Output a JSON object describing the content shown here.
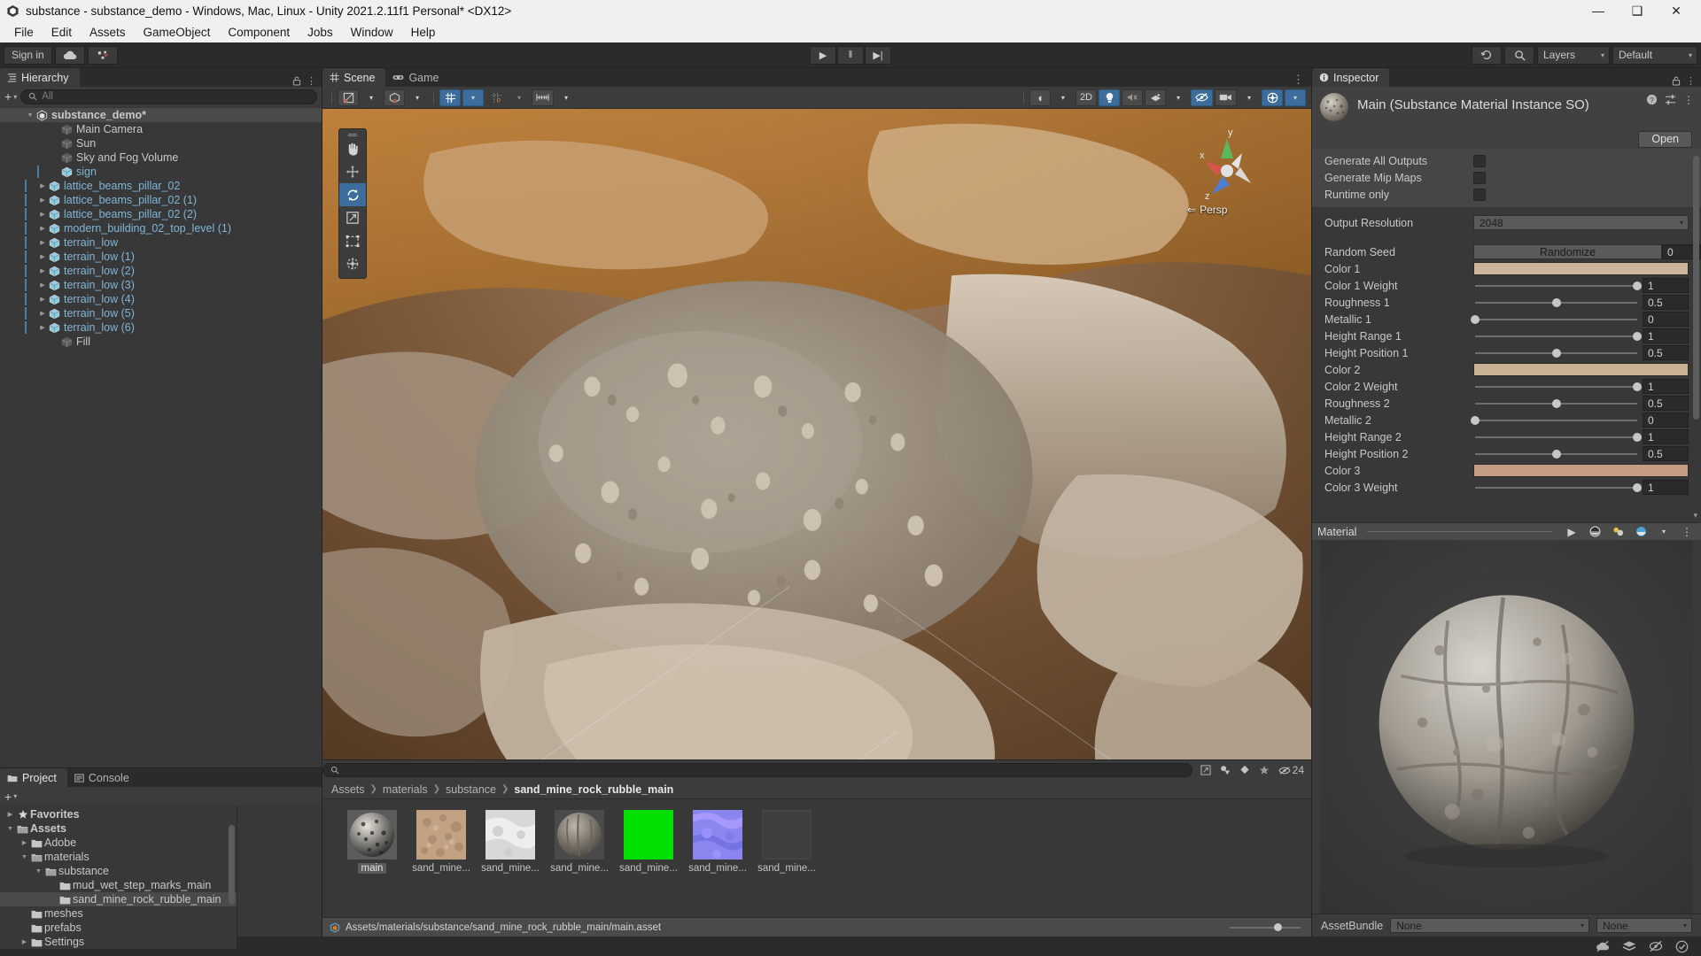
{
  "window": {
    "title": "substance - substance_demo - Windows, Mac, Linux - Unity 2021.2.11f1 Personal* <DX12>",
    "app_icon": "unity-icon",
    "minimize": "—",
    "maximize": "❑",
    "close": "✕"
  },
  "menu": {
    "items": [
      "File",
      "Edit",
      "Assets",
      "GameObject",
      "Component",
      "Jobs",
      "Window",
      "Help"
    ]
  },
  "toolbar": {
    "signin_label": "Sign in",
    "cloud_icon": "cloud-icon",
    "collab_icon": "collab-icon",
    "play_icon": "▶",
    "pause_icon": "‖",
    "step_icon": "▶|",
    "history_icon": "undo-history-icon",
    "search_icon": "search-icon",
    "layers_label": "Layers",
    "layout_label": "Default",
    "caret": "▾"
  },
  "hierarchy": {
    "tab_label": "Hierarchy",
    "tab_icon": "hierarchy-icon",
    "add_icon": "+",
    "search_placeholder": "All",
    "search_icon": "search-icon",
    "lock_icon": "lock-icon",
    "menu_icon": "⋮",
    "items": [
      {
        "label": "substance_demo*",
        "depth": 0,
        "icon": "scene-icon",
        "expand": "▼",
        "selected": true,
        "prefab": false
      },
      {
        "label": "Main Camera",
        "depth": 2,
        "icon": "gameobject-icon",
        "expand": "",
        "selected": false,
        "prefab": false
      },
      {
        "label": "Sun",
        "depth": 2,
        "icon": "gameobject-icon",
        "expand": "",
        "selected": false,
        "prefab": false
      },
      {
        "label": "Sky and Fog Volume",
        "depth": 2,
        "icon": "gameobject-icon",
        "expand": "",
        "selected": false,
        "prefab": false
      },
      {
        "label": "sign",
        "depth": 2,
        "icon": "prefab-icon",
        "expand": "",
        "selected": false,
        "prefab": true
      },
      {
        "label": "lattice_beams_pillar_02",
        "depth": 1,
        "icon": "prefab-icon",
        "expand": "▶",
        "selected": false,
        "prefab": true
      },
      {
        "label": "lattice_beams_pillar_02 (1)",
        "depth": 1,
        "icon": "prefab-icon",
        "expand": "▶",
        "selected": false,
        "prefab": true
      },
      {
        "label": "lattice_beams_pillar_02 (2)",
        "depth": 1,
        "icon": "prefab-icon",
        "expand": "▶",
        "selected": false,
        "prefab": true
      },
      {
        "label": "modern_building_02_top_level (1)",
        "depth": 1,
        "icon": "prefab-icon",
        "expand": "▶",
        "selected": false,
        "prefab": true
      },
      {
        "label": "terrain_low",
        "depth": 1,
        "icon": "prefab-icon",
        "expand": "▶",
        "selected": false,
        "prefab": true
      },
      {
        "label": "terrain_low (1)",
        "depth": 1,
        "icon": "prefab-icon",
        "expand": "▶",
        "selected": false,
        "prefab": true
      },
      {
        "label": "terrain_low (2)",
        "depth": 1,
        "icon": "prefab-icon",
        "expand": "▶",
        "selected": false,
        "prefab": true
      },
      {
        "label": "terrain_low (3)",
        "depth": 1,
        "icon": "prefab-icon",
        "expand": "▶",
        "selected": false,
        "prefab": true
      },
      {
        "label": "terrain_low (4)",
        "depth": 1,
        "icon": "prefab-icon",
        "expand": "▶",
        "selected": false,
        "prefab": true
      },
      {
        "label": "terrain_low (5)",
        "depth": 1,
        "icon": "prefab-icon",
        "expand": "▶",
        "selected": false,
        "prefab": true
      },
      {
        "label": "terrain_low (6)",
        "depth": 1,
        "icon": "prefab-icon",
        "expand": "▶",
        "selected": false,
        "prefab": true
      },
      {
        "label": "Fill",
        "depth": 2,
        "icon": "gameobject-icon",
        "expand": "",
        "selected": false,
        "prefab": false
      }
    ]
  },
  "scene": {
    "tab_scene": "Scene",
    "tab_game": "Game",
    "scene_icon": "grid-icon",
    "game_icon": "gamepad-icon",
    "menu_icon": "⋮",
    "tools": [
      {
        "name": "hand-tool",
        "glyph": "✋",
        "active": false
      },
      {
        "name": "move-tool",
        "glyph": "✥",
        "active": false
      },
      {
        "name": "rotate-tool",
        "glyph": "⟳",
        "active": true
      },
      {
        "name": "scale-tool",
        "glyph": "⤡",
        "active": false
      },
      {
        "name": "rect-tool",
        "glyph": "⬚",
        "active": false
      },
      {
        "name": "transform-tool",
        "glyph": "✸",
        "active": false
      }
    ],
    "toolbar_right": [
      {
        "name": "shading-mode",
        "label": "◐",
        "active": false,
        "caret": true
      },
      {
        "name": "2d-toggle",
        "label": "2D",
        "active": false,
        "caret": false
      },
      {
        "name": "lighting-toggle",
        "label": "💡",
        "active": true,
        "caret": false
      },
      {
        "name": "audio-toggle",
        "label": "🔊",
        "active": false,
        "caret": false
      },
      {
        "name": "effects-toggle",
        "label": "❆",
        "active": false,
        "caret": true
      },
      {
        "name": "scene-visibility-toggle",
        "label": "👁",
        "active": true,
        "caret": false
      },
      {
        "name": "camera-settings",
        "label": "■",
        "active": false,
        "caret": true
      },
      {
        "name": "gizmos-toggle",
        "label": "⊙",
        "active": true,
        "caret": true
      }
    ],
    "gizmo": {
      "x_label": "x",
      "y_label": "y",
      "z_label": "z",
      "projection_label": "Persp",
      "x_color": "#d9534f",
      "y_color": "#5cb85c",
      "z_color": "#4a7fd4"
    }
  },
  "inspector": {
    "tab_label": "Inspector",
    "tab_icon": "info-icon",
    "lock_icon": "lock-icon",
    "menu_icon": "⋮",
    "asset_title": "Main (Substance Material Instance SO)",
    "help_icon": "help-icon",
    "preset_icon": "preset-icon",
    "open_label": "Open",
    "toggles": [
      {
        "label": "Generate All Outputs",
        "checked": false
      },
      {
        "label": "Generate Mip Maps",
        "checked": false
      },
      {
        "label": "Runtime only",
        "checked": false
      }
    ],
    "output_resolution": {
      "label": "Output Resolution",
      "value": "2048"
    },
    "random_seed": {
      "label": "Random Seed",
      "button": "Randomize",
      "value": "0"
    },
    "properties": [
      {
        "label": "Color 1",
        "kind": "color",
        "color": "#cfb49c"
      },
      {
        "label": "Color 1 Weight",
        "kind": "slider",
        "value": "1",
        "pct": 100
      },
      {
        "label": "Roughness 1",
        "kind": "slider",
        "value": "0.5",
        "pct": 50
      },
      {
        "label": "Metallic 1",
        "kind": "slider",
        "value": "0",
        "pct": 0
      },
      {
        "label": "Height Range 1",
        "kind": "slider",
        "value": "1",
        "pct": 100
      },
      {
        "label": "Height Position 1",
        "kind": "slider",
        "value": "0.5",
        "pct": 50
      },
      {
        "label": "Color 2",
        "kind": "color",
        "color": "#c9b293"
      },
      {
        "label": "Color 2 Weight",
        "kind": "slider",
        "value": "1",
        "pct": 100
      },
      {
        "label": "Roughness 2",
        "kind": "slider",
        "value": "0.5",
        "pct": 50
      },
      {
        "label": "Metallic 2",
        "kind": "slider",
        "value": "0",
        "pct": 0
      },
      {
        "label": "Height Range 2",
        "kind": "slider",
        "value": "1",
        "pct": 100
      },
      {
        "label": "Height Position 2",
        "kind": "slider",
        "value": "0.5",
        "pct": 50
      },
      {
        "label": "Color 3",
        "kind": "color",
        "color": "#c69c84"
      },
      {
        "label": "Color 3 Weight",
        "kind": "slider",
        "value": "1",
        "pct": 100
      }
    ],
    "material_bar": {
      "label": "Material",
      "icons": [
        "play-icon",
        "sphere-icon",
        "lights-icon",
        "sky-icon",
        "more-icon"
      ]
    },
    "assetbundle": {
      "label": "AssetBundle",
      "value": "None",
      "variant": "None"
    }
  },
  "project": {
    "tab_project": "Project",
    "tab_console": "Console",
    "project_icon": "folder-icon",
    "console_icon": "console-icon",
    "add_icon": "+",
    "lock_icon": "lock-icon",
    "menu_icon": "⋮",
    "search_placeholder": "",
    "search_icon": "search-icon",
    "filter_icons": [
      "save-search-icon",
      "type-filter-icon",
      "label-filter-icon",
      "favorite-icon"
    ],
    "hidden_count": "24",
    "hidden_icon": "hidden-eye-icon",
    "tree": [
      {
        "label": "Favorites",
        "depth": 0,
        "arrow": "▶",
        "icon": "star-icon",
        "selected": false
      },
      {
        "label": "Assets",
        "depth": 0,
        "arrow": "▼",
        "icon": "folder-open-icon",
        "selected": false
      },
      {
        "label": "Adobe",
        "depth": 1,
        "arrow": "▶",
        "icon": "folder-icon",
        "selected": false
      },
      {
        "label": "materials",
        "depth": 1,
        "arrow": "▼",
        "icon": "folder-open-icon",
        "selected": false
      },
      {
        "label": "substance",
        "depth": 2,
        "arrow": "▼",
        "icon": "folder-open-icon",
        "selected": false
      },
      {
        "label": "mud_wet_step_marks_main",
        "depth": 3,
        "arrow": "",
        "icon": "folder-icon",
        "selected": false
      },
      {
        "label": "sand_mine_rock_rubble_main",
        "depth": 3,
        "arrow": "",
        "icon": "folder-icon",
        "selected": true
      },
      {
        "label": "meshes",
        "depth": 1,
        "arrow": "",
        "icon": "folder-icon",
        "selected": false
      },
      {
        "label": "prefabs",
        "depth": 1,
        "arrow": "",
        "icon": "folder-icon",
        "selected": false
      },
      {
        "label": "Settings",
        "depth": 1,
        "arrow": "▶",
        "icon": "folder-icon",
        "selected": false
      }
    ],
    "breadcrumb": [
      "Assets",
      "materials",
      "substance",
      "sand_mine_rock_rubble_main"
    ],
    "assets": [
      {
        "label": "main",
        "kind": "sphere-dark",
        "selected": true
      },
      {
        "label": "sand_mine...",
        "kind": "basecolor",
        "selected": false
      },
      {
        "label": "sand_mine...",
        "kind": "height",
        "selected": false
      },
      {
        "label": "sand_mine...",
        "kind": "sphere-gray",
        "selected": false
      },
      {
        "label": "sand_mine...",
        "kind": "green",
        "selected": false
      },
      {
        "label": "sand_mine...",
        "kind": "normal",
        "selected": false
      },
      {
        "label": "sand_mine...",
        "kind": "empty",
        "selected": false
      }
    ],
    "selected_path": "Assets/materials/substance/sand_mine_rock_rubble_main/main.asset",
    "path_icon": "asset-icon"
  },
  "statusbar": {
    "icons": [
      "no-collab-icon",
      "layers-status-icon",
      "no-anim-icon",
      "ok-icon"
    ]
  },
  "colors": {
    "accent_blue": "#3c6d9c",
    "panel_bg": "#383838",
    "dark_bg": "#2b2b2b",
    "toggle_bg": "#464646",
    "text": "#c4c4c4",
    "prefab_text": "#7fb6d9"
  }
}
